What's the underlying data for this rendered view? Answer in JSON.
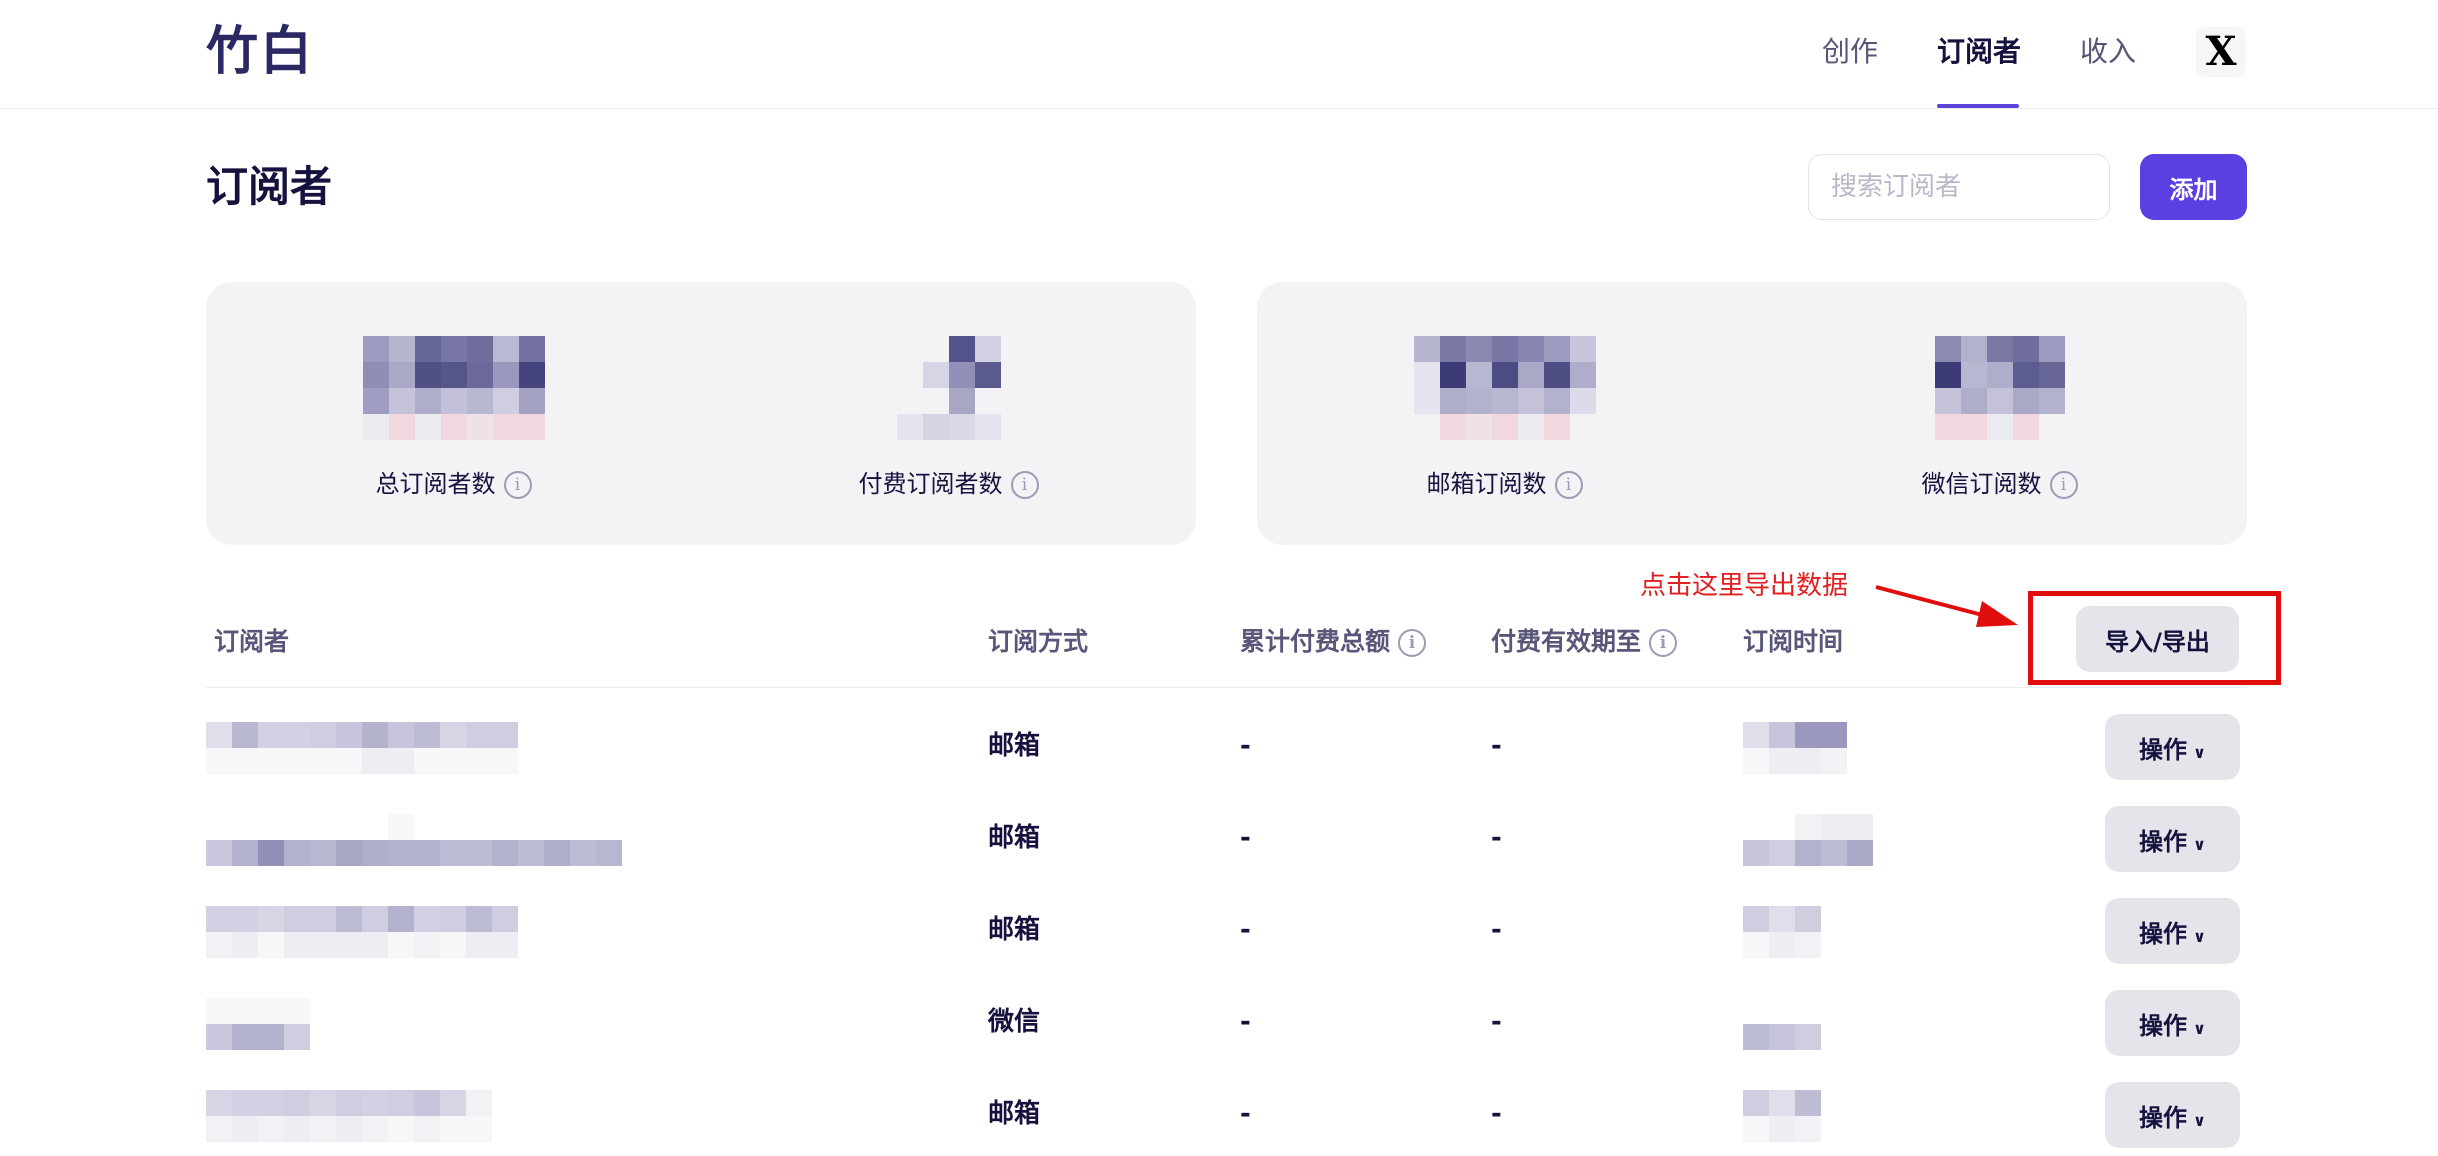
{
  "app": {
    "logo": "竹白"
  },
  "nav": {
    "items": [
      {
        "label": "创作",
        "active": false
      },
      {
        "label": "订阅者",
        "active": true
      },
      {
        "label": "收入",
        "active": false
      }
    ],
    "x_label": "X"
  },
  "header": {
    "title": "订阅者",
    "search_placeholder": "搜索订阅者",
    "add_label": "添加"
  },
  "stats": {
    "cards": [
      {
        "items": [
          {
            "label": "总订阅者数",
            "info": "i"
          },
          {
            "label": "付费订阅者数",
            "info": "i"
          }
        ]
      },
      {
        "items": [
          {
            "label": "邮箱订阅数",
            "info": "i"
          },
          {
            "label": "微信订阅数",
            "info": "i"
          }
        ]
      }
    ]
  },
  "annotation": {
    "text": "点击这里导出数据",
    "color": "#e02020"
  },
  "table": {
    "columns": [
      {
        "label": "订阅者"
      },
      {
        "label": "订阅方式"
      },
      {
        "label": "累计付费总额",
        "info": "i"
      },
      {
        "label": "付费有效期至",
        "info": "i"
      },
      {
        "label": "订阅时间"
      }
    ],
    "import_export_label": "导入/导出",
    "rows": [
      {
        "method": "邮箱",
        "total": "-",
        "expiry": "-",
        "action": "操作"
      },
      {
        "method": "邮箱",
        "total": "-",
        "expiry": "-",
        "action": "操作"
      },
      {
        "method": "邮箱",
        "total": "-",
        "expiry": "-",
        "action": "操作"
      },
      {
        "method": "微信",
        "total": "-",
        "expiry": "-",
        "action": "操作"
      },
      {
        "method": "邮箱",
        "total": "-",
        "expiry": "-",
        "action": "操作"
      }
    ]
  },
  "colors": {
    "accent": "#5b3fe0",
    "highlight_box": "#e00d0d",
    "text_dark": "#15133d"
  }
}
